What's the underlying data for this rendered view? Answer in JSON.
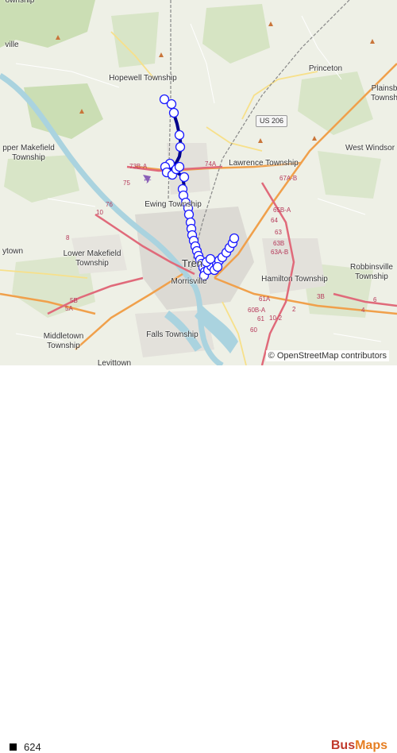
{
  "map": {
    "places": [
      {
        "name": "Hopewell Township",
        "id": "hopewell"
      },
      {
        "name": "Princeton",
        "id": "princeton"
      },
      {
        "name": "Plainsb\nTownsh",
        "id": "plainsboro"
      },
      {
        "name": "West Windsor",
        "id": "westwindsor"
      },
      {
        "name": "Lawrence Township",
        "id": "lawrence"
      },
      {
        "name": "pper Makefield\nTownship",
        "id": "uppermakefield"
      },
      {
        "name": "Ewing Township",
        "id": "ewing"
      },
      {
        "name": "Lower Makefield\nTownship",
        "id": "lowermakefield"
      },
      {
        "name": "ytown",
        "id": "yardley"
      },
      {
        "name": "Tren",
        "id": "trenton"
      },
      {
        "name": "Morrisville",
        "id": "morrisville"
      },
      {
        "name": "Hamilton Township",
        "id": "hamilton"
      },
      {
        "name": "Robbinsville\nTownship",
        "id": "robbinsville"
      },
      {
        "name": "Middletown\nTownship",
        "id": "middletown"
      },
      {
        "name": "Falls Township",
        "id": "falls"
      },
      {
        "name": "Levittown",
        "id": "levittown"
      },
      {
        "name": "ville",
        "id": "pennington"
      },
      {
        "name": "ownship",
        "id": "topcut"
      }
    ],
    "road_shield": "US 206",
    "exit_labels": [
      "73B-A",
      "74A",
      "75",
      "76",
      "10",
      "8",
      "67A-B",
      "65B-A",
      "64",
      "63B",
      "63A-B",
      "63",
      "61A",
      "60B-A",
      "2",
      "3B",
      "10-2",
      "61",
      "60",
      "5B",
      "5A",
      "6",
      "4"
    ],
    "attribution": "© OpenStreetMap contributors"
  },
  "legend": {
    "route": "624",
    "route_color": "#000000"
  },
  "route_style": {
    "line_color": "#00008b",
    "stop_fill": "#ffffff",
    "stop_stroke": "#1a1aff"
  },
  "brand": {
    "part1": "Bus",
    "part2": "Maps"
  }
}
